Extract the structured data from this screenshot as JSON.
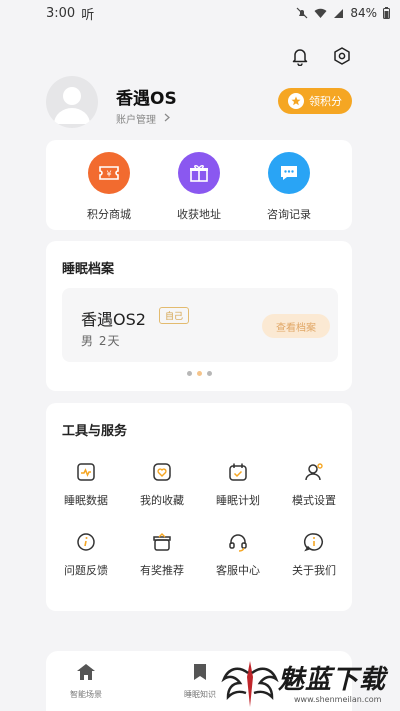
{
  "status_bar": {
    "time": "3:00",
    "carrier_glyph": "听",
    "battery": "84%"
  },
  "icons": {
    "bell": "bell-icon",
    "settings": "hexagon-gear-icon"
  },
  "profile": {
    "name": "香遇OS",
    "account_link": "账户管理",
    "points_button": "领积分"
  },
  "quick_actions": [
    {
      "label": "积分商城",
      "icon": "ticket-yen-icon",
      "color": "#f26b2f"
    },
    {
      "label": "收获地址",
      "icon": "gift-icon",
      "color": "#8a58f0"
    },
    {
      "label": "咨询记录",
      "icon": "chat-bubble-icon",
      "color": "#29a4f5"
    }
  ],
  "sleep": {
    "title": "睡眠档案",
    "profile_name": "香遇OS2",
    "badge": "自己",
    "meta": "男  2天",
    "view_button": "查看档案"
  },
  "tools": {
    "title": "工具与服务",
    "items": [
      {
        "label": "睡眠数据",
        "icon": "sleep-data-icon"
      },
      {
        "label": "我的收藏",
        "icon": "favorite-heart-icon"
      },
      {
        "label": "睡眠计划",
        "icon": "calendar-check-icon"
      },
      {
        "label": "模式设置",
        "icon": "user-settings-icon"
      },
      {
        "label": "问题反馈",
        "icon": "info-circle-icon"
      },
      {
        "label": "有奖推荐",
        "icon": "gift-box-icon"
      },
      {
        "label": "客服中心",
        "icon": "headset-icon"
      },
      {
        "label": "关于我们",
        "icon": "about-info-icon"
      }
    ]
  },
  "tabbar": [
    {
      "label": "智能场景",
      "icon": "home-icon"
    },
    {
      "label": "睡眠知识",
      "icon": "bookmark-icon"
    }
  ],
  "watermark": {
    "text": "魅蓝下载",
    "url": "www.shenmeilan.com"
  },
  "colors": {
    "accent": "#f5a623",
    "background": "#f4f4f6"
  }
}
